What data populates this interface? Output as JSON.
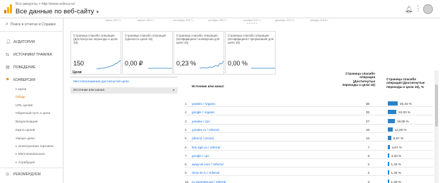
{
  "header": {
    "breadcrumb": "Все аккаунты > http://www.ozlinca.ru/",
    "view_title": "Все данные по веб-сайту",
    "icons": [
      "bell-icon",
      "more-vert-icon",
      "avatar"
    ]
  },
  "sidebar": {
    "search_placeholder": "Поиск в отчетах и Справке",
    "items": [
      {
        "label": "Аудитория",
        "icon": "person-icon"
      },
      {
        "label": "Источники трафика",
        "icon": "traffic-icon"
      },
      {
        "label": "Поведение",
        "icon": "behavior-icon"
      },
      {
        "label": "Конверсии",
        "icon": "flag-icon"
      }
    ],
    "subitems": [
      "Цели",
      "Обзор",
      "URL целей",
      "Обратный путь к цели",
      "Визуализация",
      "Карта целей",
      "Умные цели",
      "Электронная торговля",
      "Многоканальные",
      "Атрибуция"
    ],
    "current": "Обзор",
    "recommended": "Рекомендуем"
  },
  "timeline": {
    "labels": [
      "июль 2017 г.",
      "август 2017 г.",
      "сентябрь 2017 г.",
      "октябрь 2017 г.",
      "ноябрь 2017 г.",
      "декабрь 2017 г.",
      "январь 2018 г."
    ]
  },
  "cards": [
    {
      "label": "Страница спасибо операция (Достигнутые переходы к цели 15)",
      "value": "150"
    },
    {
      "label": "Страница спасибо операция (Ценность цели 15)",
      "value": "0,00 ₽"
    },
    {
      "label": "Страница спасибо операция (Коэффициент конверсии для цели 15)",
      "value": "0,23 %"
    },
    {
      "label": "Страница спасибо операция (Коэффициент прерывания для цели 15)",
      "value": "0,00 %"
    }
  ],
  "goals": {
    "heading": "Цели",
    "link": "Местоположение достигнутой цели",
    "selected": "Источник или канал"
  },
  "table": {
    "col_source": "Источник или канал",
    "col_count": "Страница спасибо операция (Достигнутые переходы к цели 15)",
    "col_pct": "Страница спасибо операция (Достигнутые переходы к цели 15), %",
    "rows": [
      {
        "num": "1.",
        "src": "yandex / organic",
        "count": "38",
        "pct": "25,33 %",
        "share": 25.33
      },
      {
        "num": "2.",
        "src": "google / organic",
        "count": "33",
        "pct": "22,00 %",
        "share": 22.0
      },
      {
        "num": "3.",
        "src": "yandex / cpc",
        "count": "27",
        "pct": "18,00 %",
        "share": 18.0
      },
      {
        "num": "4.",
        "src": "yandex.ru / referral",
        "count": "18",
        "pct": "12,00 %",
        "share": 12.0
      },
      {
        "num": "5.",
        "src": "(direct) / (none)",
        "count": "13",
        "pct": "8,67 %",
        "share": 8.67
      },
      {
        "num": "6.",
        "src": "link.2gis.ru / referral",
        "count": "7",
        "pct": "4,67 %",
        "share": 4.67
      },
      {
        "num": "7.",
        "src": "google / cpc",
        "count": "5",
        "pct": "3,33 %",
        "share": 3.33
      },
      {
        "num": "8.",
        "src": "away.vk.com / referral",
        "count": "2",
        "pct": "1,33 %",
        "share": 1.33
      },
      {
        "num": "9.",
        "src": "clinic-kr.ru / referral",
        "count": "2",
        "pct": "1,33 %",
        "share": 1.33
      },
      {
        "num": "10.",
        "src": "ru.zapmeta.ws / referral",
        "count": "2",
        "pct": "1,33 %",
        "share": 1.33
      }
    ]
  },
  "colors": {
    "accent": "#e37400",
    "link": "#1a73e8",
    "bar": "#2a83c9"
  }
}
